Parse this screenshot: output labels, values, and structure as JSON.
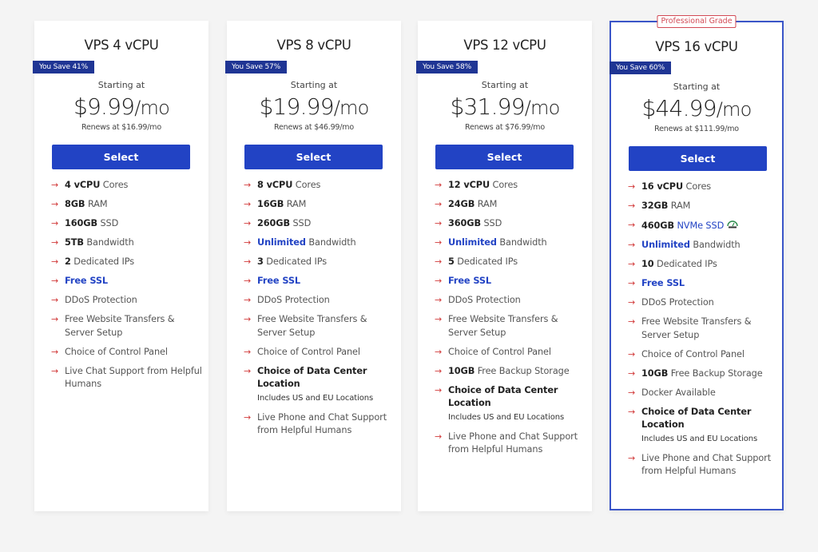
{
  "plans": [
    {
      "title": "VPS 4 vCPU",
      "save_badge": "You Save 41%",
      "starting_label": "Starting at",
      "price": "$9.99",
      "per": "/mo",
      "renews": "Renews at $16.99/mo",
      "select_label": "Select",
      "features": [
        {
          "bold": "4 vCPU",
          "text": " Cores"
        },
        {
          "bold": "8GB",
          "text": " RAM"
        },
        {
          "bold": "160GB",
          "text": " SSD"
        },
        {
          "bold": "5TB",
          "text": " Bandwidth"
        },
        {
          "bold": "2",
          "text": " Dedicated IPs"
        },
        {
          "blue_bold": "Free SSL"
        },
        {
          "text": "DDoS Protection"
        },
        {
          "text": "Free Website Transfers & Server Setup"
        },
        {
          "text": "Choice of Control Panel"
        },
        {
          "text": "Live Chat Support from Helpful Humans"
        }
      ]
    },
    {
      "title": "VPS 8 vCPU",
      "save_badge": "You Save 57%",
      "starting_label": "Starting at",
      "price": "$19.99",
      "per": "/mo",
      "renews": "Renews at $46.99/mo",
      "select_label": "Select",
      "features": [
        {
          "bold": "8 vCPU",
          "text": " Cores"
        },
        {
          "bold": "16GB",
          "text": " RAM"
        },
        {
          "bold": "260GB",
          "text": " SSD"
        },
        {
          "blue_bold": "Unlimited",
          "text": " Bandwidth"
        },
        {
          "bold": "3",
          "text": " Dedicated IPs"
        },
        {
          "blue_bold": "Free SSL"
        },
        {
          "text": "DDoS Protection"
        },
        {
          "text": "Free Website Transfers & Server Setup"
        },
        {
          "text": "Choice of Control Panel"
        },
        {
          "strong": "Choice of Data Center Location",
          "sub": "Includes US and EU Locations"
        },
        {
          "text": "Live Phone and Chat Support from Helpful Humans"
        }
      ]
    },
    {
      "title": "VPS 12 vCPU",
      "save_badge": "You Save 58%",
      "starting_label": "Starting at",
      "price": "$31.99",
      "per": "/mo",
      "renews": "Renews at $76.99/mo",
      "select_label": "Select",
      "features": [
        {
          "bold": "12 vCPU",
          "text": " Cores"
        },
        {
          "bold": "24GB",
          "text": " RAM"
        },
        {
          "bold": "360GB",
          "text": " SSD"
        },
        {
          "blue_bold": "Unlimited",
          "text": " Bandwidth"
        },
        {
          "bold": "5",
          "text": " Dedicated IPs"
        },
        {
          "blue_bold": "Free SSL"
        },
        {
          "text": "DDoS Protection"
        },
        {
          "text": "Free Website Transfers & Server Setup"
        },
        {
          "text": "Choice of Control Panel"
        },
        {
          "bold": "10GB",
          "text": " Free Backup Storage"
        },
        {
          "strong": "Choice of Data Center Location",
          "sub": "Includes US and EU Locations"
        },
        {
          "text": "Live Phone and Chat Support from Helpful Humans"
        }
      ]
    },
    {
      "title": "VPS 16 vCPU",
      "tag": "Professional Grade",
      "save_badge": "You Save 60%",
      "starting_label": "Starting at",
      "price": "$44.99",
      "per": "/mo",
      "renews": "Renews at $111.99/mo",
      "select_label": "Select",
      "features": [
        {
          "bold": "16 vCPU",
          "text": " Cores"
        },
        {
          "bold": "32GB",
          "text": " RAM"
        },
        {
          "bold": "460GB",
          "blue_text": " NVMe SSD",
          "icon": "speed-gauge-icon"
        },
        {
          "blue_bold": "Unlimited",
          "text": " Bandwidth"
        },
        {
          "bold": "10",
          "text": " Dedicated IPs"
        },
        {
          "blue_bold": "Free SSL"
        },
        {
          "text": "DDoS Protection"
        },
        {
          "text": "Free Website Transfers & Server Setup"
        },
        {
          "text": "Choice of Control Panel"
        },
        {
          "bold": "10GB",
          "text": " Free Backup Storage"
        },
        {
          "text": "Docker Available"
        },
        {
          "strong": "Choice of Data Center Location",
          "sub": "Includes US and EU Locations"
        },
        {
          "text": "Live Phone and Chat Support from Helpful Humans"
        }
      ]
    }
  ],
  "icons": {
    "bullet": "arrow-right-icon",
    "arrow_glyph": "→",
    "speed_label": "SPEED"
  },
  "colors": {
    "primary_blue": "#2243c4",
    "badge_navy": "#1f3594",
    "arrow_red": "#d23a3a",
    "tag_red": "#d24a55",
    "featured_border": "#3a55c8",
    "background": "#f4f4f4"
  }
}
